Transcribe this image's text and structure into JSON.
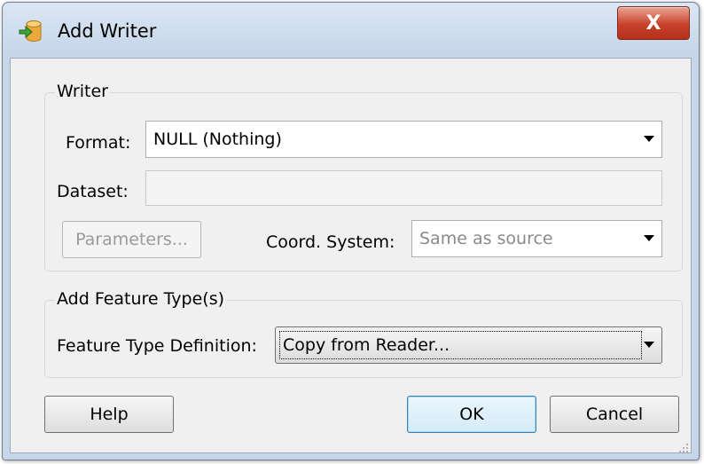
{
  "window": {
    "title": "Add Writer",
    "close_label": "X"
  },
  "writer_group": {
    "label": "Writer",
    "format": {
      "label": "Format:",
      "value": "NULL (Nothing)"
    },
    "dataset": {
      "label": "Dataset:",
      "value": ""
    },
    "parameters_button": "Parameters...",
    "coord_system": {
      "label": "Coord. System:",
      "value": "Same as source"
    }
  },
  "feature_group": {
    "label": "Add Feature Type(s)",
    "definition": {
      "label": "Feature Type Definition:",
      "value": "Copy from Reader..."
    }
  },
  "buttons": {
    "help": "Help",
    "ok": "OK",
    "cancel": "Cancel"
  },
  "colors": {
    "close_button": "#c8412a",
    "default_button_border": "#3c7fb1"
  },
  "icons": {
    "app": "database-arrow-icon",
    "close": "close-icon",
    "grip": "resize-grip-icon"
  }
}
